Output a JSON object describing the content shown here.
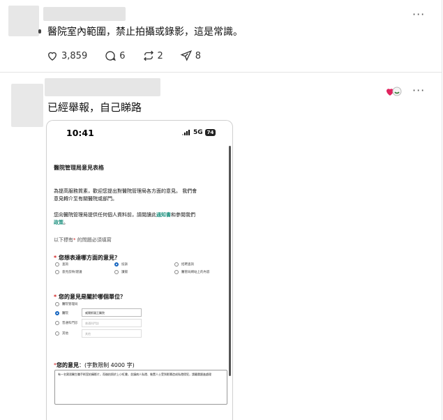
{
  "post1": {
    "text": "醫院室內範圍，禁止拍攝或錄影，這是常識。",
    "more_label": "···",
    "likes": "3,859",
    "comments": "6",
    "reposts": "2",
    "shares": "8",
    "icons": [
      "heart-icon",
      "comment-icon",
      "repost-icon",
      "share-icon"
    ]
  },
  "post2": {
    "text": "已經舉報，自己睇路",
    "more_label": "···",
    "reaction_icon": "heart-emoji-reaction-icon"
  },
  "phone": {
    "time": "10:41",
    "network": "5G",
    "battery": "74",
    "form": {
      "title": "醫院管理局意見表格",
      "intro_line1": "為提高服務質素，歡迎您提出對醫院管理局各方面的意見。 我們會",
      "intro_line2": "意見轉介至有關醫院或部門。",
      "privacy_pre": "您向醫院管理局提供任何個人資料前，請閱讀此",
      "privacy_link1": "通知書",
      "privacy_mid": "和參閱我們",
      "privacy_link2": "政策",
      "privacy_post": "。",
      "required_pre": "以下標有",
      "required_star": "*",
      "required_post": " 的問題必須填寫",
      "q1": {
        "star": "*",
        "label": " 您想表達哪方面的意見？",
        "options": [
          "查詢",
          "投訴",
          "招聘查詢",
          "意見反映/建議",
          "讚揚",
          "醫管局網站上的內容"
        ],
        "selected": "投訴"
      },
      "q2": {
        "star": "*",
        "label": " 您的意見是關於哪個單位？",
        "options": [
          "醫院管理局",
          "醫院",
          "普通科門診",
          "其他"
        ],
        "selected": "醫院",
        "hospital_value": "威爾斯親王醫院",
        "clinic_placeholder": "普通科門診",
        "other_placeholder": "其他"
      },
      "opinion": {
        "star": "*",
        "label": "您的意見",
        "limit": "：(字數限制 4000 字)",
        "value": "有一名實習醫生職手術室拍攝影片，而後拍照於上小紅書，並讓病人私隱、裝置人士受到影響造成私隱侵犯，請嚴肅跟進處理"
      }
    }
  },
  "colors": {
    "accent_link": "#1a8f7d",
    "required_star": "#d02020",
    "radio_selected": "#1565c0"
  }
}
